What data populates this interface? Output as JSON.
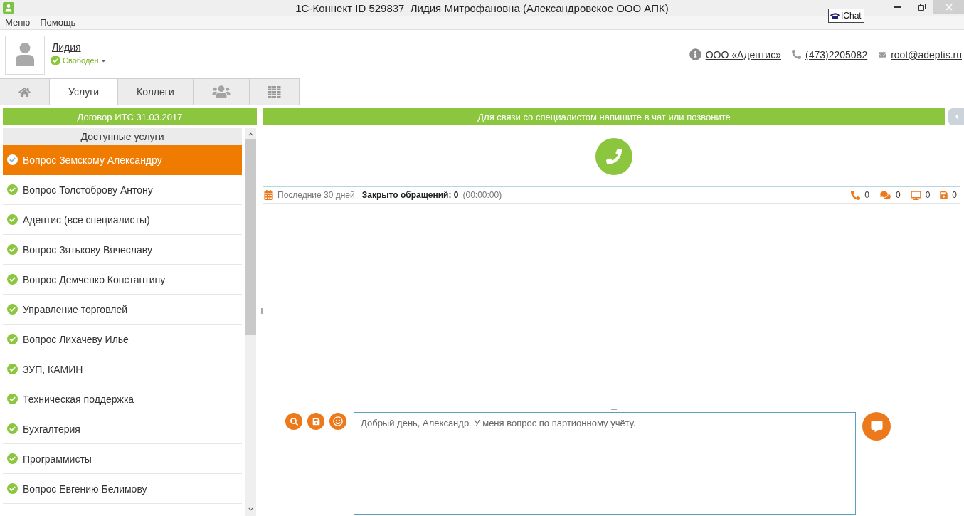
{
  "window": {
    "title": "1С-Коннект ID 529837  Лидия Митрофановна (Александровское ООО АПК)",
    "overlay_label": "IChat"
  },
  "menu": [
    {
      "label": "Меню"
    },
    {
      "label": "Помощь"
    }
  ],
  "profile": {
    "name": "Лидия",
    "status": "Свободен"
  },
  "contacts": [
    {
      "kind": "info",
      "text": "ООО «Адептис»"
    },
    {
      "kind": "phone",
      "text": "(473)2205082"
    },
    {
      "kind": "email",
      "text": "root@adeptis.ru"
    }
  ],
  "tabs": [
    {
      "kind": "home",
      "selected": false
    },
    {
      "kind": "text",
      "label": "Услуги",
      "selected": true
    },
    {
      "kind": "text",
      "label": "Коллеги",
      "selected": false
    },
    {
      "kind": "group",
      "selected": false
    },
    {
      "kind": "grid",
      "selected": false
    }
  ],
  "services": {
    "title": "Договор ИТС 31.03.2017",
    "subtitle": "Доступные услуги",
    "items": [
      {
        "label": "Вопрос Земскому Александру",
        "selected": true
      },
      {
        "label": "Вопрос Толстоброву Антону",
        "selected": false
      },
      {
        "label": "Адептис (все специалисты)",
        "selected": false
      },
      {
        "label": "Вопрос Зятькову Вячеславу",
        "selected": false
      },
      {
        "label": "Вопрос Демченко Константину",
        "selected": false
      },
      {
        "label": "Управление торговлей",
        "selected": false
      },
      {
        "label": "Вопрос Лихачеву Илье",
        "selected": false
      },
      {
        "label": "ЗУП, КАМИН",
        "selected": false
      },
      {
        "label": "Техническая поддержка",
        "selected": false
      },
      {
        "label": "Бухгалтерия",
        "selected": false
      },
      {
        "label": "Программисты",
        "selected": false
      },
      {
        "label": "Вопрос Евгению Белимову",
        "selected": false
      }
    ]
  },
  "chat": {
    "banner": "Для связи со специалистом напишите в чат или позвоните",
    "stats": {
      "period": "Последние 30 дней",
      "closed": "Закрыто обращений: 0",
      "duration": "(00:00:00)",
      "counters": [
        {
          "kind": "calls",
          "value": "0"
        },
        {
          "kind": "chats",
          "value": "0"
        },
        {
          "kind": "screens",
          "value": "0"
        },
        {
          "kind": "files",
          "value": "0"
        }
      ]
    },
    "tools": [
      {
        "kind": "search"
      },
      {
        "kind": "save"
      },
      {
        "kind": "emoji"
      }
    ],
    "message": {
      "value": "Добрый день, Александр. У меня вопрос по партионному учёту."
    }
  }
}
